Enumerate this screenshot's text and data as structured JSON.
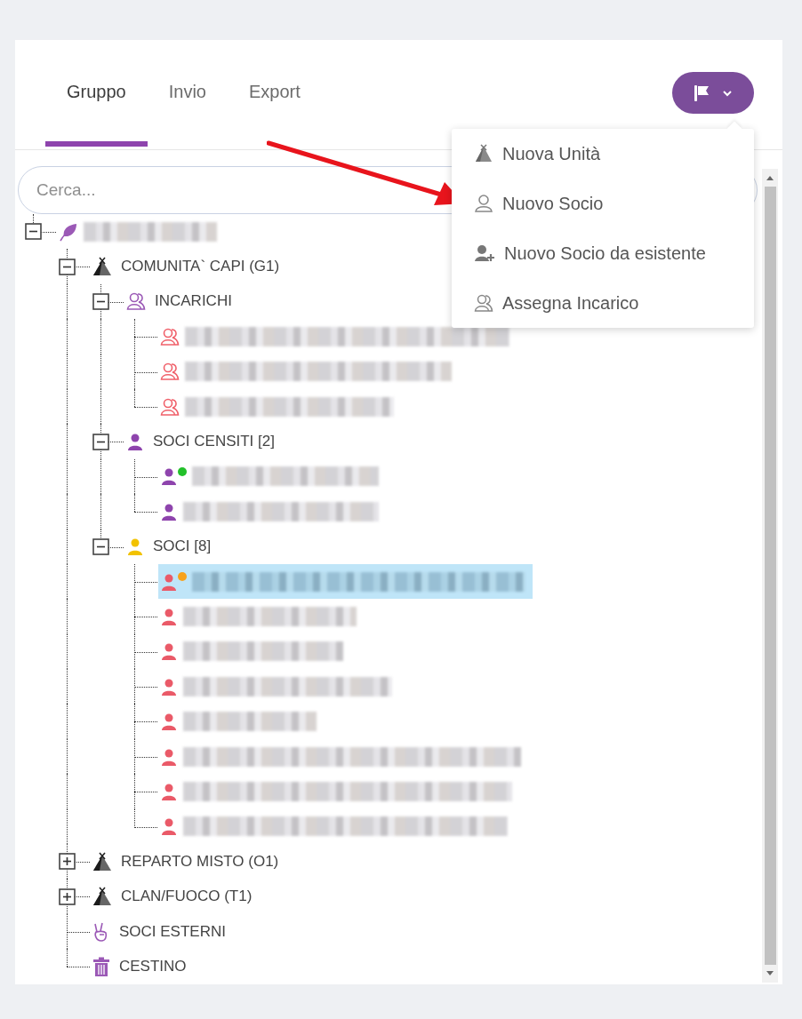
{
  "tabs": [
    {
      "label": "Gruppo",
      "selected": true
    },
    {
      "label": "Invio",
      "selected": false
    },
    {
      "label": "Export",
      "selected": false
    }
  ],
  "action_menu": {
    "items": [
      {
        "kind": "unit",
        "label": "Nuova Unità"
      },
      {
        "kind": "member",
        "label": "Nuovo Socio"
      },
      {
        "kind": "member_from_existing",
        "label": "Nuovo Socio da esistente"
      },
      {
        "kind": "role",
        "label": "Assegna Incarico"
      }
    ]
  },
  "search": {
    "placeholder": "Cerca..."
  },
  "tree": [
    {
      "kind": "group",
      "redacted": true,
      "expanded": true,
      "selected": false,
      "children": [
        {
          "kind": "unit",
          "label": "COMUNITA` CAPI (G1)",
          "expanded": true,
          "selected": false,
          "children": [
            {
              "kind": "roles",
              "label": "INCARICHI",
              "color": "#9b59b6",
              "expanded": true,
              "selected": false,
              "children": [
                {
                  "kind": "role",
                  "redacted": true,
                  "color": "#f0606a",
                  "selected": false
                },
                {
                  "kind": "role",
                  "redacted": true,
                  "color": "#f0606a",
                  "selected": false
                },
                {
                  "kind": "role",
                  "redacted": true,
                  "color": "#f0606a",
                  "selected": false
                }
              ]
            },
            {
              "kind": "member",
              "label": "SOCI CENSITI [2]",
              "color": "#8e44ad",
              "expanded": true,
              "selected": false,
              "children": [
                {
                  "kind": "member",
                  "redacted": true,
                  "color": "#8e44ad",
                  "status_dot": {
                    "color": "#22c02a"
                  },
                  "selected": false
                },
                {
                  "kind": "member",
                  "redacted": true,
                  "color": "#8e44ad",
                  "selected": false
                }
              ]
            },
            {
              "kind": "member",
              "label": "SOCI [8]",
              "color": "#f2c200",
              "expanded": true,
              "selected": false,
              "children": [
                {
                  "kind": "member",
                  "redacted": true,
                  "color": "#ea5a68",
                  "status_dot": {
                    "color": "#f7a21b"
                  },
                  "selected": true
                },
                {
                  "kind": "member",
                  "redacted": true,
                  "color": "#ea5a68",
                  "selected": false
                },
                {
                  "kind": "member",
                  "redacted": true,
                  "color": "#ea5a68",
                  "selected": false
                },
                {
                  "kind": "member",
                  "redacted": true,
                  "color": "#ea5a68",
                  "selected": false
                },
                {
                  "kind": "member",
                  "redacted": true,
                  "color": "#ea5a68",
                  "selected": false
                },
                {
                  "kind": "member",
                  "redacted": true,
                  "color": "#ea5a68",
                  "selected": false
                },
                {
                  "kind": "member",
                  "redacted": true,
                  "color": "#ea5a68",
                  "selected": false
                },
                {
                  "kind": "member",
                  "redacted": true,
                  "color": "#ea5a68",
                  "selected": false
                }
              ]
            }
          ]
        },
        {
          "kind": "unit",
          "label": "REPARTO MISTO (O1)",
          "expanded": false,
          "selected": false
        },
        {
          "kind": "unit",
          "label": "CLAN/FUOCO (T1)",
          "expanded": false,
          "selected": false
        },
        {
          "kind": "external",
          "label": "SOCI ESTERNI",
          "selected": false
        },
        {
          "kind": "trash",
          "label": "CESTINO",
          "selected": false
        }
      ]
    }
  ]
}
